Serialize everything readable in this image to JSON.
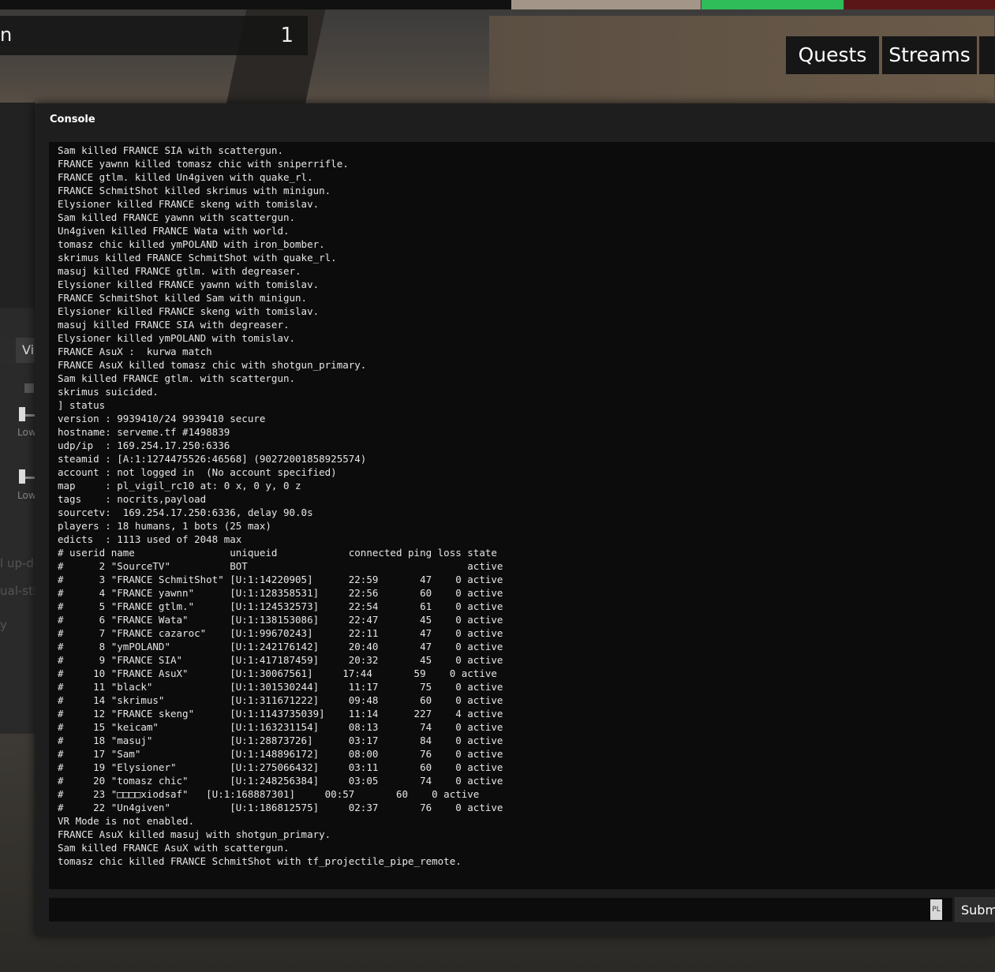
{
  "hud": {
    "score_label": "n",
    "score_value": "1",
    "nav": {
      "quests": "Quests",
      "streams": "Streams"
    }
  },
  "side": {
    "tab_label": "Vi",
    "slider1_label": "Low",
    "slider2_label": "Low",
    "faint1": "l up-de",
    "faint2": "ual-stic",
    "faint3": "y"
  },
  "console": {
    "title": "Console",
    "lines": [
      "Sam killed FRANCE SIA with scattergun.",
      "FRANCE yawnn killed tomasz chic with sniperrifle.",
      "FRANCE gtlm. killed Un4given with quake_rl.",
      "FRANCE SchmitShot killed skrimus with minigun.",
      "Elysioner killed FRANCE skeng with tomislav.",
      "Sam killed FRANCE yawnn with scattergun.",
      "Un4given killed FRANCE Wata with world.",
      "tomasz chic killed ymPOLAND with iron_bomber.",
      "skrimus killed FRANCE SchmitShot with quake_rl.",
      "masuj killed FRANCE gtlm. with degreaser.",
      "Elysioner killed FRANCE yawnn with tomislav.",
      "FRANCE SchmitShot killed Sam with minigun.",
      "Elysioner killed FRANCE skeng with tomislav.",
      "masuj killed FRANCE SIA with degreaser.",
      "Elysioner killed ymPOLAND with tomislav.",
      "FRANCE AsuX :  kurwa match",
      "FRANCE AsuX killed tomasz chic with shotgun_primary.",
      "Sam killed FRANCE gtlm. with scattergun.",
      "skrimus suicided.",
      "] status",
      "version : 9939410/24 9939410 secure",
      "hostname: serveme.tf #1498839",
      "udp/ip  : 169.254.17.250:6336",
      "steamid : [A:1:1274475526:46568] (90272001858925574)",
      "account : not logged in  (No account specified)",
      "map     : pl_vigil_rc10 at: 0 x, 0 y, 0 z",
      "tags    : nocrits,payload",
      "sourcetv:  169.254.17.250:6336, delay 90.0s",
      "players : 18 humans, 1 bots (25 max)",
      "edicts  : 1113 used of 2048 max",
      "# userid name                uniqueid            connected ping loss state",
      "#      2 \"SourceTV\"          BOT                                     active",
      "#      3 \"FRANCE SchmitShot\" [U:1:14220905]      22:59       47    0 active",
      "#      4 \"FRANCE yawnn\"      [U:1:128358531]     22:56       60    0 active",
      "#      5 \"FRANCE gtlm.\"      [U:1:124532573]     22:54       61    0 active",
      "#      6 \"FRANCE Wata\"       [U:1:138153086]     22:47       45    0 active",
      "#      7 \"FRANCE cazaroc\"    [U:1:99670243]      22:11       47    0 active",
      "#      8 \"ymPOLAND\"          [U:1:242176142]     20:40       47    0 active",
      "#      9 \"FRANCE SIA\"        [U:1:417187459]     20:32       45    0 active",
      "#     10 \"FRANCE AsuX\"       [U:1:30067561]     17:44       59    0 active",
      "#     11 \"black\"             [U:1:301530244]     11:17       75    0 active",
      "#     14 \"skrimus\"           [U:1:311671222]     09:48       60    0 active",
      "#     12 \"FRANCE skeng\"      [U:1:1143735039]    11:14      227    4 active",
      "#     15 \"keicam\"            [U:1:163231154]     08:13       74    0 active",
      "#     18 \"masuj\"             [U:1:28873726]      03:17       84    0 active",
      "#     17 \"Sam\"               [U:1:148896172]     08:00       76    0 active",
      "#     19 \"Elysioner\"         [U:1:275066432]     03:11       60    0 active",
      "#     20 \"tomasz chic\"       [U:1:248256384]     03:05       74    0 active",
      "#     23 \"□□□□xiodsaf\"   [U:1:168887301]     00:57       60    0 active",
      "#     22 \"Un4given\"          [U:1:186812575]     02:37       76    0 active",
      "VR Mode is not enabled.",
      "FRANCE AsuX killed masuj with shotgun_primary.",
      "Sam killed FRANCE AsuX with scattergun.",
      "tomasz chic killed FRANCE SchmitShot with tf_projectile_pipe_remote."
    ],
    "input_value": "",
    "lang_badge": "PL",
    "submit_label": "Submit"
  }
}
